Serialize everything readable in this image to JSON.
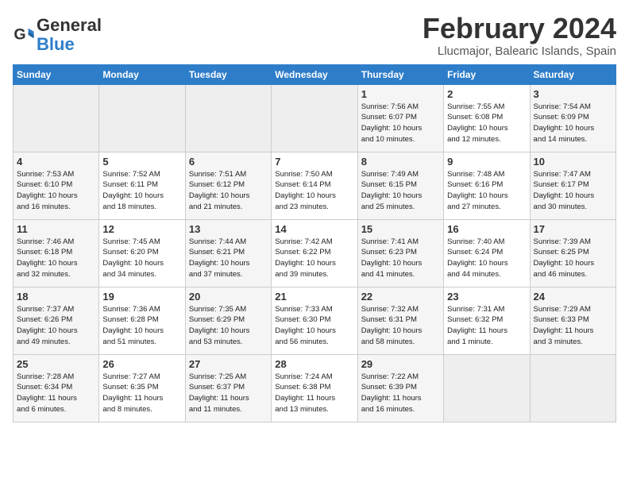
{
  "header": {
    "logo_general": "General",
    "logo_blue": "Blue",
    "title": "February 2024",
    "subtitle": "Llucmajor, Balearic Islands, Spain"
  },
  "days_of_week": [
    "Sunday",
    "Monday",
    "Tuesday",
    "Wednesday",
    "Thursday",
    "Friday",
    "Saturday"
  ],
  "weeks": [
    [
      {
        "day": "",
        "info": ""
      },
      {
        "day": "",
        "info": ""
      },
      {
        "day": "",
        "info": ""
      },
      {
        "day": "",
        "info": ""
      },
      {
        "day": "1",
        "info": "Sunrise: 7:56 AM\nSunset: 6:07 PM\nDaylight: 10 hours\nand 10 minutes."
      },
      {
        "day": "2",
        "info": "Sunrise: 7:55 AM\nSunset: 6:08 PM\nDaylight: 10 hours\nand 12 minutes."
      },
      {
        "day": "3",
        "info": "Sunrise: 7:54 AM\nSunset: 6:09 PM\nDaylight: 10 hours\nand 14 minutes."
      }
    ],
    [
      {
        "day": "4",
        "info": "Sunrise: 7:53 AM\nSunset: 6:10 PM\nDaylight: 10 hours\nand 16 minutes."
      },
      {
        "day": "5",
        "info": "Sunrise: 7:52 AM\nSunset: 6:11 PM\nDaylight: 10 hours\nand 18 minutes."
      },
      {
        "day": "6",
        "info": "Sunrise: 7:51 AM\nSunset: 6:12 PM\nDaylight: 10 hours\nand 21 minutes."
      },
      {
        "day": "7",
        "info": "Sunrise: 7:50 AM\nSunset: 6:14 PM\nDaylight: 10 hours\nand 23 minutes."
      },
      {
        "day": "8",
        "info": "Sunrise: 7:49 AM\nSunset: 6:15 PM\nDaylight: 10 hours\nand 25 minutes."
      },
      {
        "day": "9",
        "info": "Sunrise: 7:48 AM\nSunset: 6:16 PM\nDaylight: 10 hours\nand 27 minutes."
      },
      {
        "day": "10",
        "info": "Sunrise: 7:47 AM\nSunset: 6:17 PM\nDaylight: 10 hours\nand 30 minutes."
      }
    ],
    [
      {
        "day": "11",
        "info": "Sunrise: 7:46 AM\nSunset: 6:18 PM\nDaylight: 10 hours\nand 32 minutes."
      },
      {
        "day": "12",
        "info": "Sunrise: 7:45 AM\nSunset: 6:20 PM\nDaylight: 10 hours\nand 34 minutes."
      },
      {
        "day": "13",
        "info": "Sunrise: 7:44 AM\nSunset: 6:21 PM\nDaylight: 10 hours\nand 37 minutes."
      },
      {
        "day": "14",
        "info": "Sunrise: 7:42 AM\nSunset: 6:22 PM\nDaylight: 10 hours\nand 39 minutes."
      },
      {
        "day": "15",
        "info": "Sunrise: 7:41 AM\nSunset: 6:23 PM\nDaylight: 10 hours\nand 41 minutes."
      },
      {
        "day": "16",
        "info": "Sunrise: 7:40 AM\nSunset: 6:24 PM\nDaylight: 10 hours\nand 44 minutes."
      },
      {
        "day": "17",
        "info": "Sunrise: 7:39 AM\nSunset: 6:25 PM\nDaylight: 10 hours\nand 46 minutes."
      }
    ],
    [
      {
        "day": "18",
        "info": "Sunrise: 7:37 AM\nSunset: 6:26 PM\nDaylight: 10 hours\nand 49 minutes."
      },
      {
        "day": "19",
        "info": "Sunrise: 7:36 AM\nSunset: 6:28 PM\nDaylight: 10 hours\nand 51 minutes."
      },
      {
        "day": "20",
        "info": "Sunrise: 7:35 AM\nSunset: 6:29 PM\nDaylight: 10 hours\nand 53 minutes."
      },
      {
        "day": "21",
        "info": "Sunrise: 7:33 AM\nSunset: 6:30 PM\nDaylight: 10 hours\nand 56 minutes."
      },
      {
        "day": "22",
        "info": "Sunrise: 7:32 AM\nSunset: 6:31 PM\nDaylight: 10 hours\nand 58 minutes."
      },
      {
        "day": "23",
        "info": "Sunrise: 7:31 AM\nSunset: 6:32 PM\nDaylight: 11 hours\nand 1 minute."
      },
      {
        "day": "24",
        "info": "Sunrise: 7:29 AM\nSunset: 6:33 PM\nDaylight: 11 hours\nand 3 minutes."
      }
    ],
    [
      {
        "day": "25",
        "info": "Sunrise: 7:28 AM\nSunset: 6:34 PM\nDaylight: 11 hours\nand 6 minutes."
      },
      {
        "day": "26",
        "info": "Sunrise: 7:27 AM\nSunset: 6:35 PM\nDaylight: 11 hours\nand 8 minutes."
      },
      {
        "day": "27",
        "info": "Sunrise: 7:25 AM\nSunset: 6:37 PM\nDaylight: 11 hours\nand 11 minutes."
      },
      {
        "day": "28",
        "info": "Sunrise: 7:24 AM\nSunset: 6:38 PM\nDaylight: 11 hours\nand 13 minutes."
      },
      {
        "day": "29",
        "info": "Sunrise: 7:22 AM\nSunset: 6:39 PM\nDaylight: 11 hours\nand 16 minutes."
      },
      {
        "day": "",
        "info": ""
      },
      {
        "day": "",
        "info": ""
      }
    ]
  ]
}
